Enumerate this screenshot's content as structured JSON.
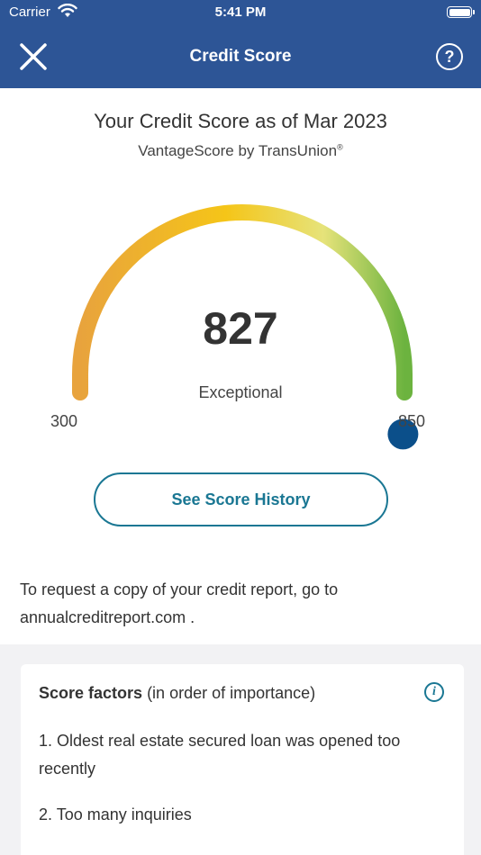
{
  "status_bar": {
    "carrier": "Carrier",
    "time": "5:41 PM"
  },
  "nav": {
    "title": "Credit Score",
    "help_label": "?"
  },
  "score_card": {
    "heading": "Your Credit Score as of Mar 2023",
    "subheading": "VantageScore by TransUnion",
    "subheading_mark": "®",
    "score": "827",
    "score_value": 827,
    "rating": "Exceptional",
    "min": "300",
    "max": "850",
    "min_value": 300,
    "max_value": 850,
    "history_button": "See Score History",
    "request_text": "To request a copy of your credit report, go to",
    "request_link": "annualcreditreport.com",
    "request_suffix": " .",
    "colors": {
      "low": "#e8a33d",
      "mid": "#f5c518",
      "high": "#e6e37a",
      "top": "#6cb33f",
      "marker": "#0b4f8a",
      "accent": "#1a7793",
      "header": "#2d5596"
    }
  },
  "factors": {
    "title_bold": "Score factors",
    "title_rest": " (in order of importance)",
    "info_label": "i",
    "items": [
      "1. Oldest real estate secured loan was opened too recently",
      "2. Too many inquiries"
    ]
  }
}
